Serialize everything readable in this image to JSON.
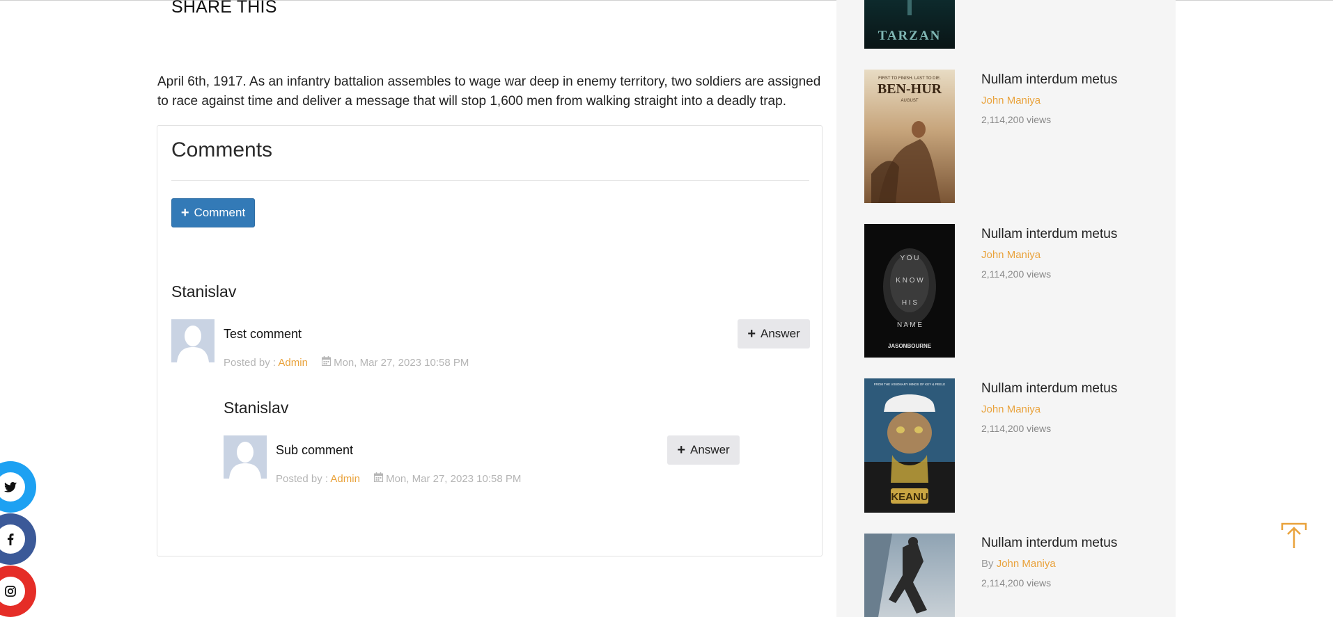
{
  "share": {
    "title": "SHARE THIS"
  },
  "description": "April 6th, 1917. As an infantry battalion assembles to wage war deep in enemy territory, two soldiers are assigned to race against time and deliver a message that will stop 1,600 men from walking straight into a deadly trap.",
  "comments": {
    "title": "Comments",
    "add_button_label": "Comment",
    "items": [
      {
        "author": "Stanislav",
        "text": "Test comment",
        "posted_by_label": "Posted by : ",
        "posted_by": "Admin",
        "date": "Mon, Mar 27, 2023 10:58 PM",
        "answer_label": "Answer",
        "replies": [
          {
            "author": "Stanislav",
            "text": "Sub comment",
            "posted_by_label": "Posted by : ",
            "posted_by": "Admin",
            "date": "Mon, Mar 27, 2023 10:58 PM",
            "answer_label": "Answer"
          }
        ]
      }
    ]
  },
  "sidebar": {
    "items": [
      {
        "poster_text": "TARZAN"
      },
      {
        "poster_text": "BEN-HUR",
        "poster_tagline": "FIRST TO FINISH. LAST TO DIE.",
        "poster_month": "AUGUST",
        "title": "Nullam interdum metus",
        "author": "John Maniya",
        "views": "2,114,200 views"
      },
      {
        "poster_text": "JASONBOURNE",
        "poster_words": [
          "Y O U",
          "K N O W",
          "H I S",
          "N A M E"
        ],
        "title": "Nullam interdum metus",
        "author": "John Maniya",
        "views": "2,114,200 views"
      },
      {
        "poster_text": "KEANU",
        "poster_tagline": "FROM THE VISIONARY MINDS OF KEY & PEELE",
        "title": "Nullam interdum metus",
        "author": "John Maniya",
        "views": "2,114,200 views"
      },
      {
        "title": "Nullam interdum metus",
        "by_label": "By ",
        "author": "John Maniya",
        "views": "2,114,200 views"
      }
    ]
  },
  "social": [
    {
      "name": "twitter",
      "color": "#1da1f2"
    },
    {
      "name": "facebook",
      "color": "#3b5998"
    },
    {
      "name": "instagram",
      "color": "#e52d27"
    }
  ],
  "accent_color": "#e9a23b"
}
